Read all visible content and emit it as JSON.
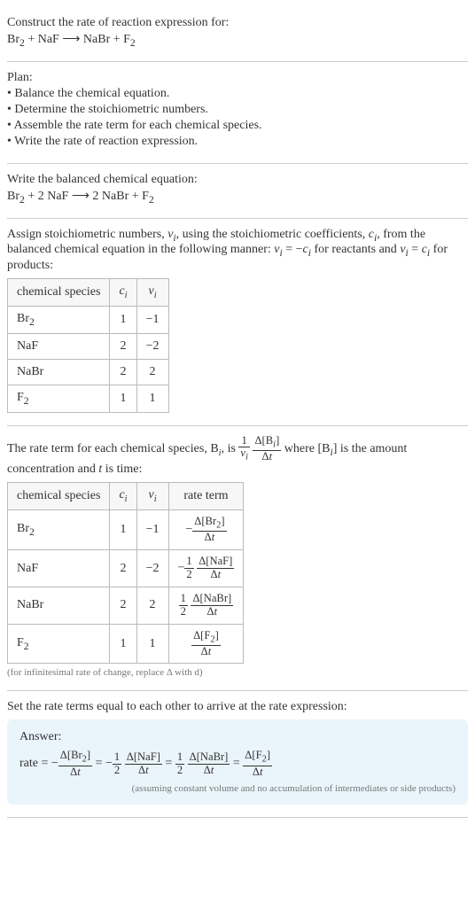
{
  "intro": {
    "prompt": "Construct the rate of reaction expression for:",
    "equation_html": "Br<sub>2</sub> + NaF ⟶ NaBr + F<sub>2</sub>"
  },
  "plan": {
    "heading": "Plan:",
    "items": [
      "Balance the chemical equation.",
      "Determine the stoichiometric numbers.",
      "Assemble the rate term for each chemical species.",
      "Write the rate of reaction expression."
    ]
  },
  "balanced": {
    "heading": "Write the balanced chemical equation:",
    "equation_html": "Br<sub>2</sub> + 2 NaF ⟶ 2 NaBr + F<sub>2</sub>"
  },
  "stoich_assign": {
    "text_html": "Assign stoichiometric numbers, <i>ν<sub>i</sub></i>, using the stoichiometric coefficients, <i>c<sub>i</sub></i>, from the balanced chemical equation in the following manner: <i>ν<sub>i</sub></i> = −<i>c<sub>i</sub></i> for reactants and <i>ν<sub>i</sub></i> = <i>c<sub>i</sub></i> for products:",
    "headers": [
      "chemical species",
      "cᵢ",
      "νᵢ"
    ],
    "rows": [
      {
        "species_html": "Br<sub>2</sub>",
        "c": "1",
        "nu": "−1"
      },
      {
        "species_html": "NaF",
        "c": "2",
        "nu": "−2"
      },
      {
        "species_html": "NaBr",
        "c": "2",
        "nu": "2"
      },
      {
        "species_html": "F<sub>2</sub>",
        "c": "1",
        "nu": "1"
      }
    ]
  },
  "rate_term": {
    "text_pre": "The rate term for each chemical species, B",
    "text_post": " is the amount concentration and <i>t</i> is time:",
    "headers": [
      "chemical species",
      "cᵢ",
      "νᵢ",
      "rate term"
    ],
    "rows": [
      {
        "species_html": "Br<sub>2</sub>",
        "c": "1",
        "nu": "−1",
        "rate_html": "−<span class=\"frac\"><span class=\"num\">Δ[Br<sub>2</sub>]</span><span class=\"den\">Δ<i>t</i></span></span>"
      },
      {
        "species_html": "NaF",
        "c": "2",
        "nu": "−2",
        "rate_html": "−<span class=\"frac\"><span class=\"num\">1</span><span class=\"den\">2</span></span> <span class=\"frac\"><span class=\"num\">Δ[NaF]</span><span class=\"den\">Δ<i>t</i></span></span>"
      },
      {
        "species_html": "NaBr",
        "c": "2",
        "nu": "2",
        "rate_html": "<span class=\"frac\"><span class=\"num\">1</span><span class=\"den\">2</span></span> <span class=\"frac\"><span class=\"num\">Δ[NaBr]</span><span class=\"den\">Δ<i>t</i></span></span>"
      },
      {
        "species_html": "F<sub>2</sub>",
        "c": "1",
        "nu": "1",
        "rate_html": "<span class=\"frac\"><span class=\"num\">Δ[F<sub>2</sub>]</span><span class=\"den\">Δ<i>t</i></span></span>"
      }
    ],
    "footnote": "(for infinitesimal rate of change, replace Δ with d)"
  },
  "final": {
    "heading": "Set the rate terms equal to each other to arrive at the rate expression:",
    "answer_label": "Answer:",
    "rate_html": "rate = −<span class=\"frac\"><span class=\"num\">Δ[Br<sub>2</sub>]</span><span class=\"den\">Δ<i>t</i></span></span> = −<span class=\"frac\"><span class=\"num\">1</span><span class=\"den\">2</span></span> <span class=\"frac\"><span class=\"num\">Δ[NaF]</span><span class=\"den\">Δ<i>t</i></span></span> = <span class=\"frac\"><span class=\"num\">1</span><span class=\"den\">2</span></span> <span class=\"frac\"><span class=\"num\">Δ[NaBr]</span><span class=\"den\">Δ<i>t</i></span></span> = <span class=\"frac\"><span class=\"num\">Δ[F<sub>2</sub>]</span><span class=\"den\">Δ<i>t</i></span></span>",
    "footnote": "(assuming constant volume and no accumulation of intermediates or side products)"
  },
  "chart_data": {
    "type": "table",
    "title": "Stoichiometric numbers and rate terms",
    "tables": [
      {
        "name": "stoichiometric_numbers",
        "columns": [
          "chemical species",
          "c_i",
          "nu_i"
        ],
        "rows": [
          [
            "Br2",
            1,
            -1
          ],
          [
            "NaF",
            2,
            -2
          ],
          [
            "NaBr",
            2,
            2
          ],
          [
            "F2",
            1,
            1
          ]
        ]
      },
      {
        "name": "rate_terms",
        "columns": [
          "chemical species",
          "c_i",
          "nu_i",
          "rate_term"
        ],
        "rows": [
          [
            "Br2",
            1,
            -1,
            "-d[Br2]/dt"
          ],
          [
            "NaF",
            2,
            -2,
            "-(1/2) d[NaF]/dt"
          ],
          [
            "NaBr",
            2,
            2,
            "(1/2) d[NaBr]/dt"
          ],
          [
            "F2",
            1,
            1,
            "d[F2]/dt"
          ]
        ]
      }
    ]
  }
}
